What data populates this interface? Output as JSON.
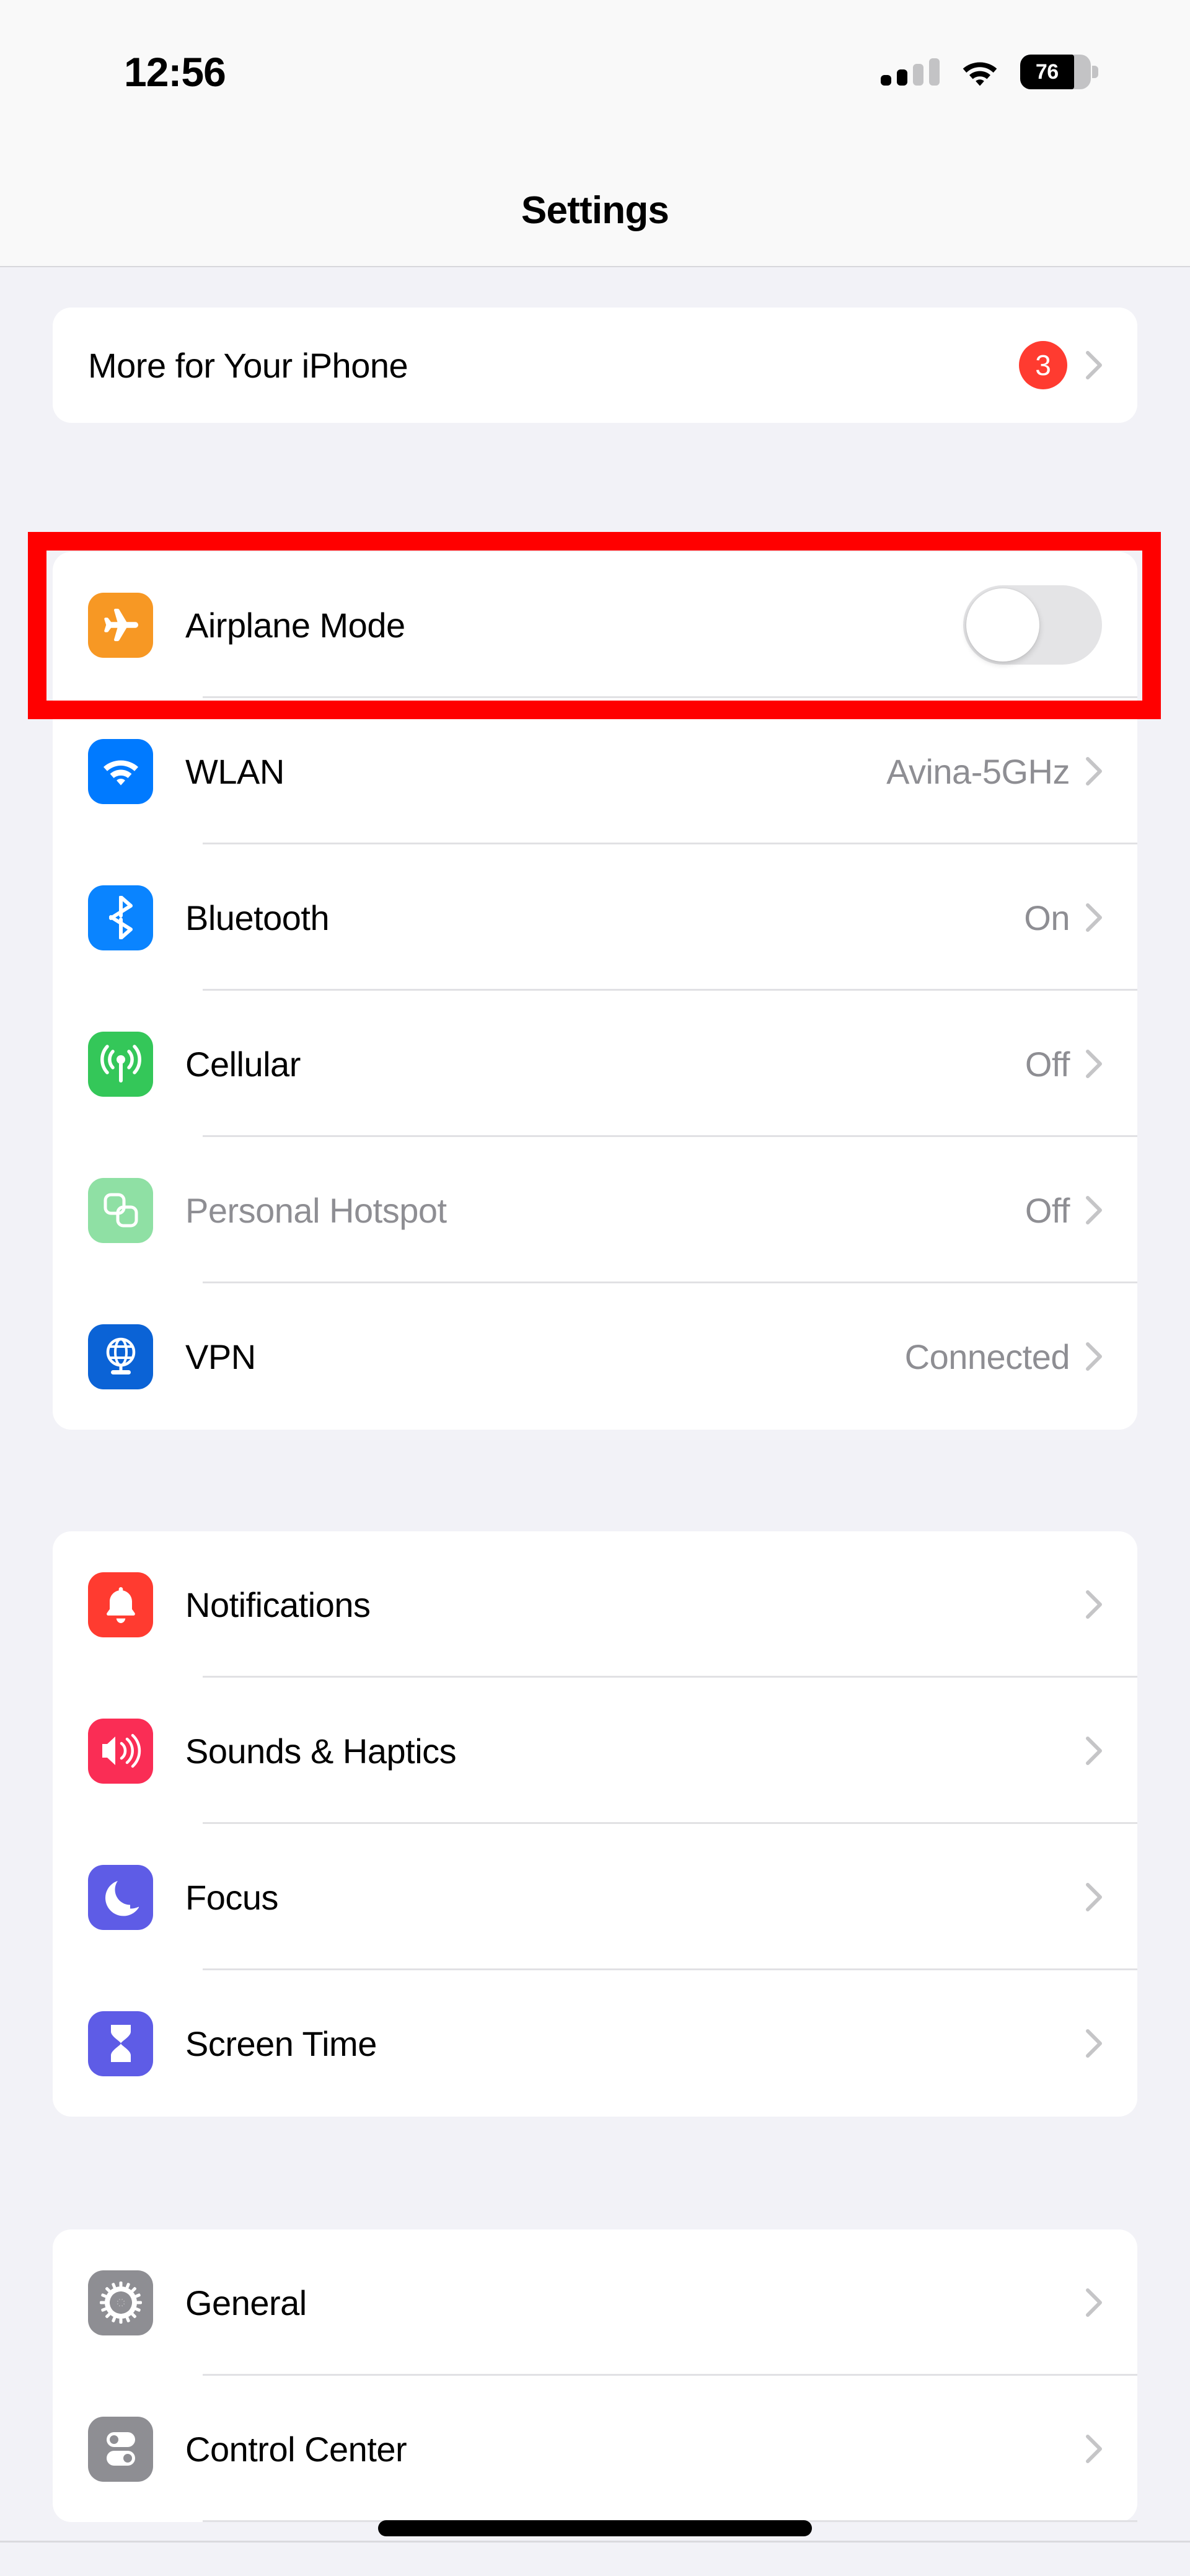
{
  "status_bar": {
    "time": "12:56",
    "signal_icon": "cellular-signal-icon",
    "signal_bars_filled": 2,
    "signal_bars_total": 4,
    "wifi_icon": "wifi-icon",
    "battery_icon": "battery-icon",
    "battery_percent": "76"
  },
  "nav": {
    "title": "Settings"
  },
  "colors": {
    "background": "#F2F2F7",
    "card": "#FFFFFF",
    "badge_red": "#FF3B30",
    "highlight_red": "#FF0000",
    "value_gray": "#8E8E93",
    "toggle_off_track": "#E4E4E6"
  },
  "groups": [
    {
      "name": "promo",
      "rows": [
        {
          "label": "More for Your iPhone",
          "badge": "3",
          "icon": null,
          "chevron": true,
          "type": "link"
        }
      ]
    },
    {
      "name": "connectivity",
      "rows": [
        {
          "label": "Airplane Mode",
          "icon": "airplane-icon",
          "icon_color": "#F79824",
          "type": "toggle",
          "toggle_on": false,
          "highlighted": true
        },
        {
          "label": "WLAN",
          "value": "Avina-5GHz",
          "icon": "wifi-icon",
          "icon_color": "#007AFF",
          "chevron": true,
          "type": "link"
        },
        {
          "label": "Bluetooth",
          "value": "On",
          "icon": "bluetooth-icon",
          "icon_color": "#0A84FF",
          "chevron": true,
          "type": "link"
        },
        {
          "label": "Cellular",
          "value": "Off",
          "icon": "cellular-antenna-icon",
          "icon_color": "#34C759",
          "chevron": true,
          "type": "link"
        },
        {
          "label": "Personal Hotspot",
          "value": "Off",
          "icon": "personal-hotspot-icon",
          "icon_color": "#8FE0A4",
          "chevron": true,
          "type": "link",
          "disabled": true
        },
        {
          "label": "VPN",
          "value": "Connected",
          "icon": "vpn-globe-icon",
          "icon_color": "#0B63D6",
          "chevron": true,
          "type": "link"
        }
      ]
    },
    {
      "name": "alerts",
      "rows": [
        {
          "label": "Notifications",
          "icon": "bell-icon",
          "icon_color": "#FF3B30",
          "chevron": true,
          "type": "link"
        },
        {
          "label": "Sounds & Haptics",
          "icon": "speaker-waves-icon",
          "icon_color": "#FA2D55",
          "chevron": true,
          "type": "link"
        },
        {
          "label": "Focus",
          "icon": "moon-icon",
          "icon_color": "#5E5CE6",
          "chevron": true,
          "type": "link"
        },
        {
          "label": "Screen Time",
          "icon": "hourglass-icon",
          "icon_color": "#5E5CE6",
          "chevron": true,
          "type": "link"
        }
      ]
    },
    {
      "name": "system",
      "rows": [
        {
          "label": "General",
          "icon": "gear-icon",
          "icon_color": "#8E8E93",
          "chevron": true,
          "type": "link"
        },
        {
          "label": "Control Center",
          "icon": "control-center-icon",
          "icon_color": "#8E8E93",
          "chevron": true,
          "type": "link"
        }
      ]
    }
  ],
  "home_indicator": "home-indicator"
}
